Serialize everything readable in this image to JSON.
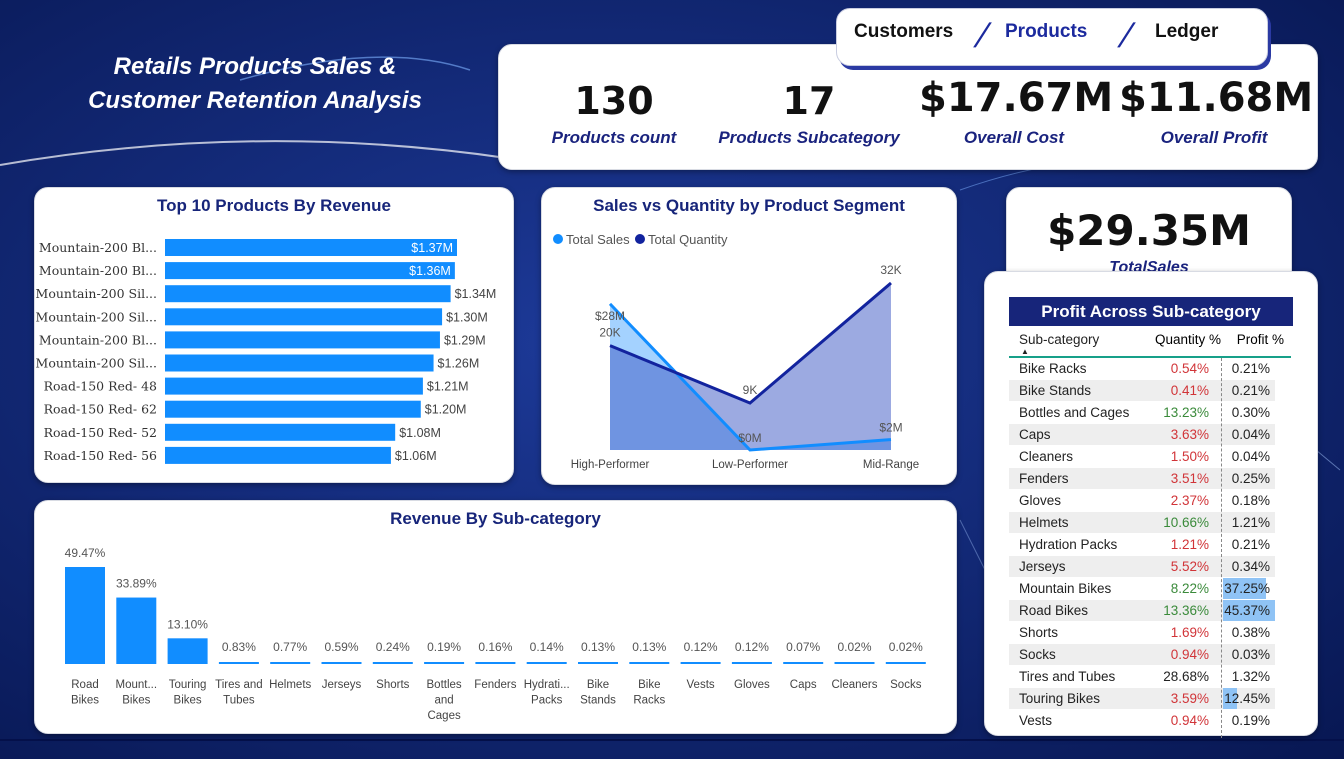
{
  "header": {
    "title_line1": "Retails Products Sales &",
    "title_line2": "Customer Retention Analysis"
  },
  "nav": {
    "items": [
      {
        "label": "Customers",
        "active": false
      },
      {
        "label": "Products",
        "active": true
      },
      {
        "label": "Ledger",
        "active": false
      }
    ],
    "separator": "/"
  },
  "kpis": [
    {
      "value": "130",
      "label": "Products count"
    },
    {
      "value": "17",
      "label": "Products Subcategory"
    },
    {
      "value": "$17.67M",
      "label": "Overall Cost"
    },
    {
      "value": "$11.68M",
      "label": "Overall Profit"
    }
  ],
  "total_sales": {
    "value": "$29.35M",
    "label": "TotalSales"
  },
  "colors": {
    "accent": "#118dff",
    "dark_series": "#12239e",
    "navy": "#17257a",
    "red": "#d13438",
    "green": "#3a8a3a",
    "highlight": "#8fc3f5"
  },
  "chart_data": [
    {
      "type": "bar",
      "orientation": "horizontal",
      "title": "Top 10 Products By Revenue",
      "categories": [
        "Mountain-200 Bl...",
        "Mountain-200 Bl...",
        "Mountain-200 Sil...",
        "Mountain-200 Sil...",
        "Mountain-200 Bl...",
        "Mountain-200 Sil...",
        "Road-150 Red- 48",
        "Road-150 Red- 62",
        "Road-150 Red- 52",
        "Road-150 Red- 56"
      ],
      "values": [
        1.37,
        1.36,
        1.34,
        1.3,
        1.29,
        1.26,
        1.21,
        1.2,
        1.08,
        1.06
      ],
      "labels": [
        "$1.37M",
        "$1.36M",
        "$1.34M",
        "$1.30M",
        "$1.29M",
        "$1.26M",
        "$1.21M",
        "$1.20M",
        "$1.08M",
        "$1.06M"
      ],
      "color": "#118dff"
    },
    {
      "type": "area",
      "title": "Sales vs Quantity by Product Segment",
      "categories": [
        "High-Performer",
        "Low-Performer",
        "Mid-Range"
      ],
      "legend_position": "top-left",
      "series": [
        {
          "name": "Total Sales",
          "values": [
            28,
            0,
            2
          ],
          "labels": [
            "$28M",
            "$0M",
            "$2M"
          ],
          "color": "#118dff"
        },
        {
          "name": "Total Quantity",
          "values": [
            20,
            9,
            32
          ],
          "labels": [
            "20K",
            "9K",
            "32K"
          ],
          "color": "#12239e"
        }
      ]
    },
    {
      "type": "bar",
      "title": "Revenue By Sub-category",
      "categories": [
        "Road Bikes",
        "Mount... Bikes",
        "Touring Bikes",
        "Tires and Tubes",
        "Helmets",
        "Jerseys",
        "Shorts",
        "Bottles and Cages",
        "Fenders",
        "Hydrati... Packs",
        "Bike Stands",
        "Bike Racks",
        "Vests",
        "Gloves",
        "Caps",
        "Cleaners",
        "Socks"
      ],
      "values": [
        49.47,
        33.89,
        13.1,
        0.83,
        0.77,
        0.59,
        0.24,
        0.19,
        0.16,
        0.14,
        0.13,
        0.13,
        0.12,
        0.12,
        0.07,
        0.02,
        0.02
      ],
      "labels": [
        "49.47%",
        "33.89%",
        "13.10%",
        "0.83%",
        "0.77%",
        "0.59%",
        "0.24%",
        "0.19%",
        "0.16%",
        "0.14%",
        "0.13%",
        "0.13%",
        "0.12%",
        "0.12%",
        "0.07%",
        "0.02%",
        "0.02%"
      ],
      "color": "#118dff"
    },
    {
      "type": "table",
      "title": "Profit Across Sub-category",
      "columns": [
        "Sub-category",
        "Quantity %",
        "Profit %"
      ],
      "rows": [
        {
          "name": "Bike Racks",
          "qty": "0.54%",
          "profit": "0.21%",
          "qty_color": "red",
          "profit_value": 0.21
        },
        {
          "name": "Bike Stands",
          "qty": "0.41%",
          "profit": "0.21%",
          "qty_color": "red",
          "profit_value": 0.21
        },
        {
          "name": "Bottles and Cages",
          "qty": "13.23%",
          "profit": "0.30%",
          "qty_color": "green",
          "profit_value": 0.3
        },
        {
          "name": "Caps",
          "qty": "3.63%",
          "profit": "0.04%",
          "qty_color": "red",
          "profit_value": 0.04
        },
        {
          "name": "Cleaners",
          "qty": "1.50%",
          "profit": "0.04%",
          "qty_color": "red",
          "profit_value": 0.04
        },
        {
          "name": "Fenders",
          "qty": "3.51%",
          "profit": "0.25%",
          "qty_color": "red",
          "profit_value": 0.25
        },
        {
          "name": "Gloves",
          "qty": "2.37%",
          "profit": "0.18%",
          "qty_color": "red",
          "profit_value": 0.18
        },
        {
          "name": "Helmets",
          "qty": "10.66%",
          "profit": "1.21%",
          "qty_color": "green",
          "profit_value": 1.21
        },
        {
          "name": "Hydration Packs",
          "qty": "1.21%",
          "profit": "0.21%",
          "qty_color": "red",
          "profit_value": 0.21
        },
        {
          "name": "Jerseys",
          "qty": "5.52%",
          "profit": "0.34%",
          "qty_color": "red",
          "profit_value": 0.34
        },
        {
          "name": "Mountain Bikes",
          "qty": "8.22%",
          "profit": "37.25%",
          "qty_color": "green",
          "profit_value": 37.25
        },
        {
          "name": "Road Bikes",
          "qty": "13.36%",
          "profit": "45.37%",
          "qty_color": "green",
          "profit_value": 45.37
        },
        {
          "name": "Shorts",
          "qty": "1.69%",
          "profit": "0.38%",
          "qty_color": "red",
          "profit_value": 0.38
        },
        {
          "name": "Socks",
          "qty": "0.94%",
          "profit": "0.03%",
          "qty_color": "red",
          "profit_value": 0.03
        },
        {
          "name": "Tires and Tubes",
          "qty": "28.68%",
          "profit": "1.32%",
          "qty_color": "black",
          "profit_value": 1.32
        },
        {
          "name": "Touring Bikes",
          "qty": "3.59%",
          "profit": "12.45%",
          "qty_color": "red",
          "profit_value": 12.45
        },
        {
          "name": "Vests",
          "qty": "0.94%",
          "profit": "0.19%",
          "qty_color": "red",
          "profit_value": 0.19
        }
      ]
    }
  ]
}
